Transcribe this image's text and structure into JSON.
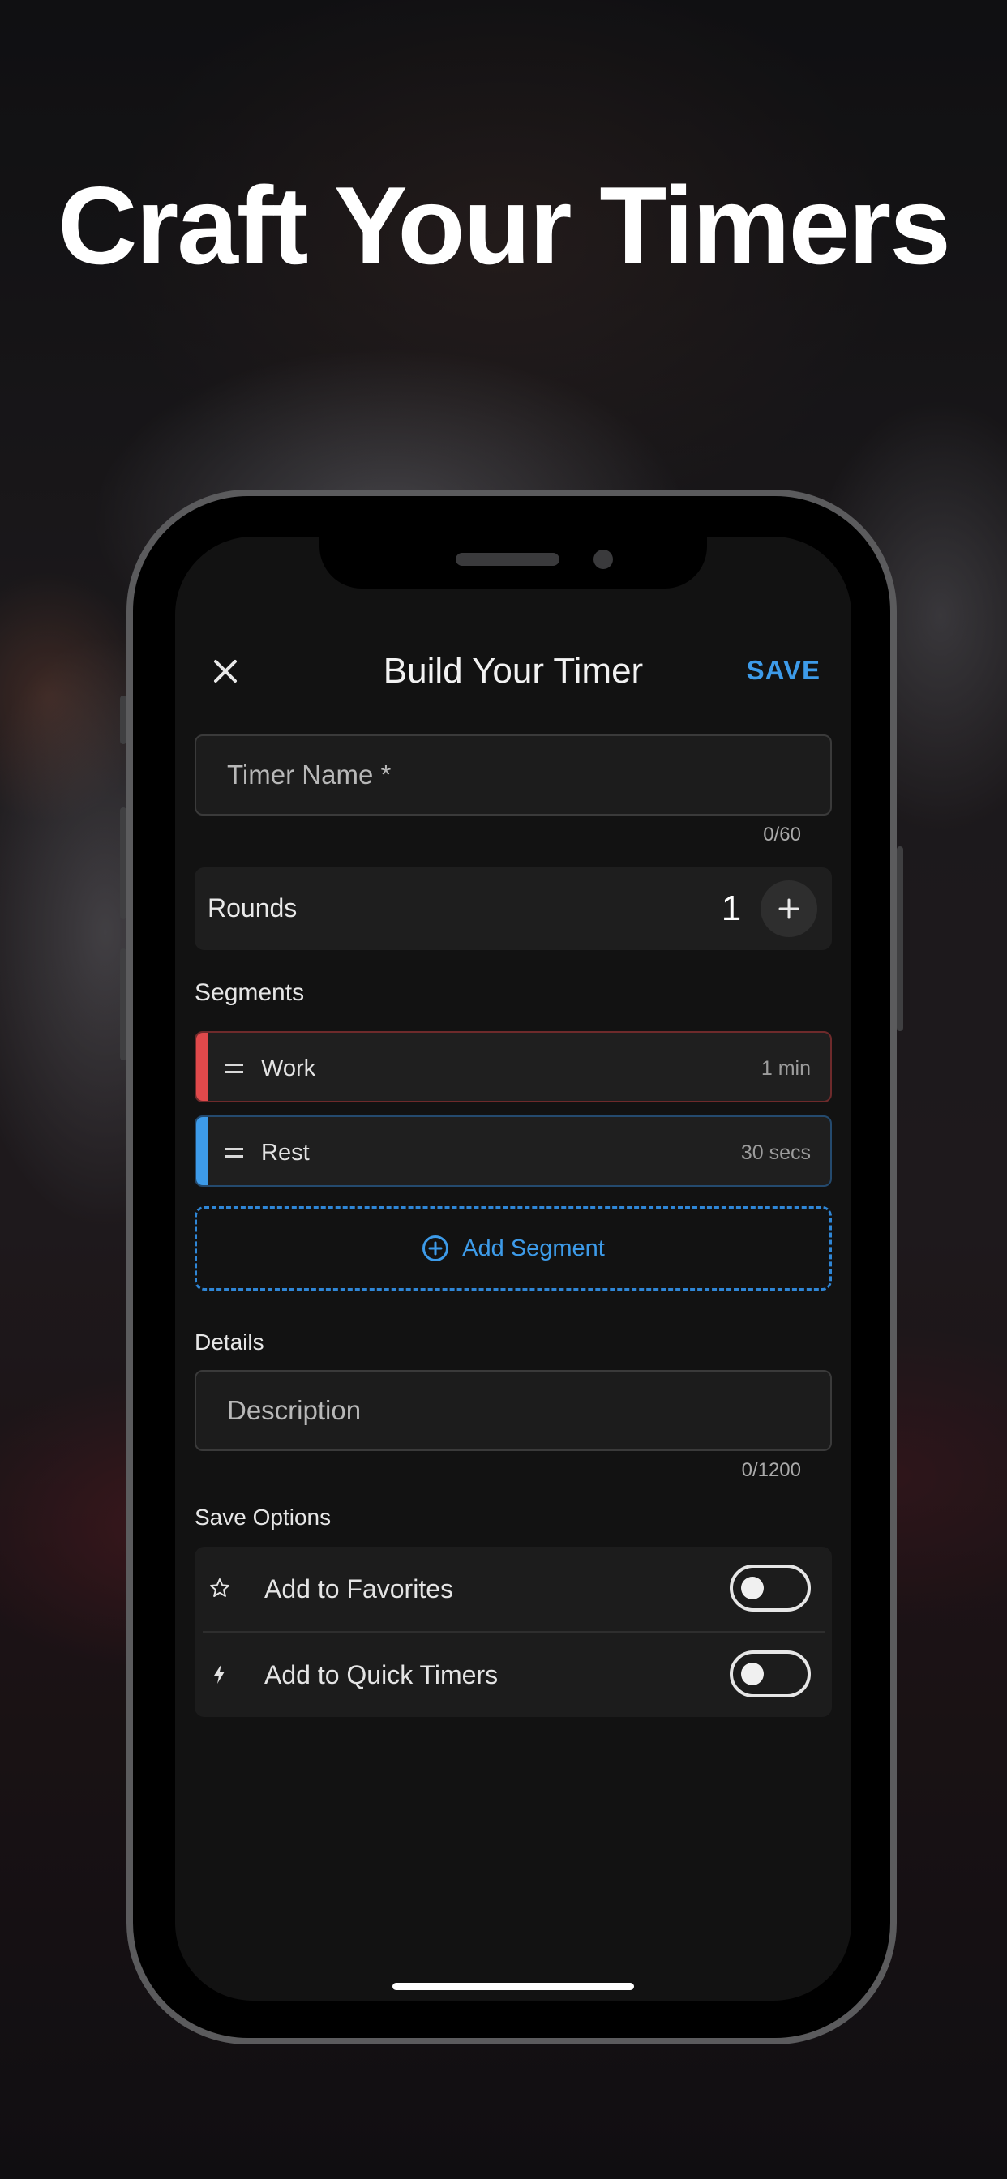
{
  "headline": "Craft Your Timers",
  "nav": {
    "close_icon": "close-icon",
    "title": "Build Your Timer",
    "save_label": "SAVE"
  },
  "timer_name": {
    "placeholder": "Timer Name *",
    "value": "",
    "counter": "0/60"
  },
  "rounds": {
    "label": "Rounds",
    "value": "1",
    "increment_icon": "plus-icon"
  },
  "segments": {
    "heading": "Segments",
    "items": [
      {
        "name": "Work",
        "duration": "1 min",
        "color": "#e0494b"
      },
      {
        "name": "Rest",
        "duration": "30 secs",
        "color": "#3d9be9"
      }
    ],
    "add_label": "Add Segment",
    "add_icon": "plus-circle-icon"
  },
  "details": {
    "heading": "Details",
    "description_placeholder": "Description",
    "description_value": "",
    "counter": "0/1200"
  },
  "save_options": {
    "heading": "Save Options",
    "items": [
      {
        "label": "Add to Favorites",
        "icon": "star-icon",
        "enabled": false
      },
      {
        "label": "Add to Quick Timers",
        "icon": "bolt-icon",
        "enabled": false
      }
    ]
  },
  "colors": {
    "accent": "#3d9be9",
    "work": "#e0494b",
    "rest": "#3d9be9",
    "screen_bg": "#121212"
  }
}
